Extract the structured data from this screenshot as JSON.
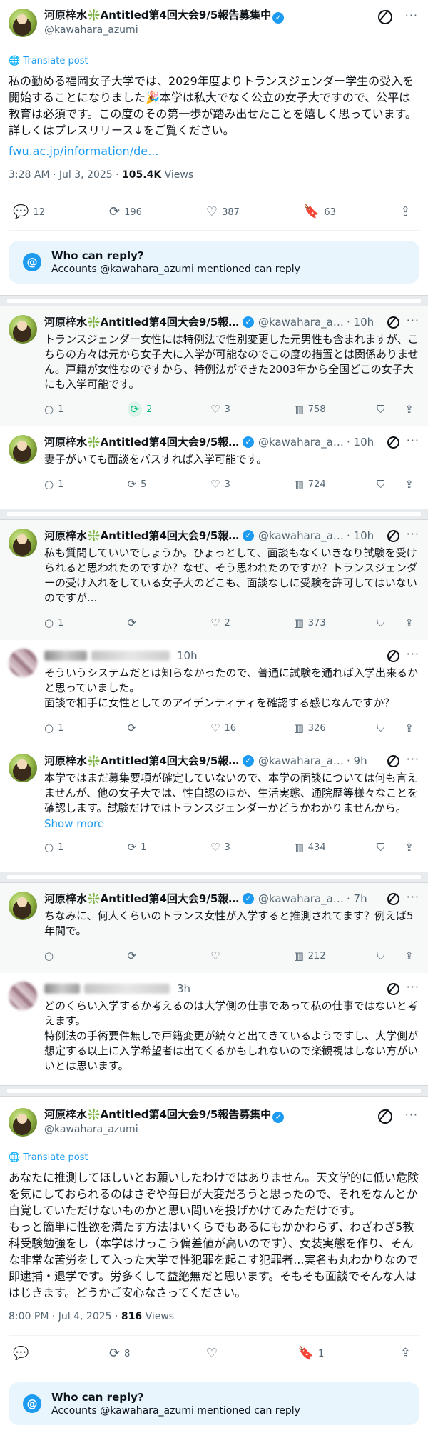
{
  "main_tweet": {
    "name": "河原梓水❇️Antitled第4回大会9/5報告募集中",
    "handle": "@kawahara_azumi",
    "translate": "Translate post",
    "text": "私の勤める福岡女子大学では、2029年度よりトランスジェンダー学生の受入を開始することになりました🎉本学は私大でなく公立の女子大ですので、公平は教育は必須です。この度のその第一歩が踏み出せたことを嬉しく思っています。詳しくはプレスリリース↓をご覧ください。",
    "link": "fwu.ac.jp/information/de...",
    "time": "3:28 AM · Jul 3, 2025 · ",
    "views": "105.4K",
    "views_label": " Views",
    "replies": "12",
    "retweets": "196",
    "likes": "387",
    "bookmarks": "63"
  },
  "reply_box": {
    "title": "Who can reply?",
    "subtitle": "Accounts @kawahara_azumi mentioned can reply"
  },
  "thread1": [
    {
      "name": "河原梓水❇️Antitled第4回大会9/5報告...",
      "handle": "@kawahara_az...",
      "time": "· 10h",
      "text": "トランスジェンダー女性には特例法で性別変更した元男性も含まれますが、こちらの方々は元から女子大に入学が可能なのでこの度の措置とは関係ありません。戸籍が女性なのですから、特例法ができた2003年から全国どこの女子大にも入学可能です。",
      "replies": "1",
      "retweets": "2",
      "likes": "3",
      "views": "758"
    },
    {
      "name": "河原梓水❇️Antitled第4回大会9/5報告...",
      "handle": "@kawahara_az...",
      "time": "· 10h",
      "text": "妻子がいても面談をパスすれば入学可能です。",
      "replies": "1",
      "retweets": "5",
      "likes": "3",
      "views": "724"
    }
  ],
  "thread2": [
    {
      "name": "河原梓水❇️Antitled第4回大会9/5報告...",
      "handle": "@kawahara_az...",
      "time": "· 10h",
      "text": "私も質問していいでしょうか。ひょっとして、面談もなくいきなり試験を受けられると思われたのですか？なぜ、そう思われたのですか？トランスジェンダーの受け入れをしている女子大のどこも、面談なしに受験を許可してはいないのですが...",
      "replies": "1",
      "retweets": "",
      "likes": "2",
      "views": "373"
    },
    {
      "time": "10h",
      "text": "そういうシステムだとは知らなかったので、普通に試験を通れば入学出来るかと思っていました。\n面談で相手に女性としてのアイデンティティを確認する感じなんですか？",
      "replies": "1",
      "retweets": "",
      "likes": "16",
      "views": "326"
    },
    {
      "name": "河原梓水❇️Antitled第4回大会9/5報告募...",
      "handle": "@kawahara_az...",
      "time": "· 9h",
      "text": "本学ではまだ募集要項が確定していないので、本学の面談については何も言えませんが、他の女子大では、性自認のほか、生活実態、通院歴等様々なことを確認します。試験だけではトランスジェンダーかどうかわかりませんから。",
      "show_more": "Show more",
      "replies": "1",
      "retweets": "1",
      "likes": "3",
      "views": "434"
    }
  ],
  "thread3": [
    {
      "name": "河原梓水❇️Antitled第4回大会9/5報告募...",
      "handle": "@kawahara_az...",
      "time": "· 7h",
      "text": "ちなみに、何人くらいのトランス女性が入学すると推測されてます？例えば5年間で。",
      "replies": "",
      "retweets": "",
      "likes": "",
      "views": "212"
    },
    {
      "time": "3h",
      "text": "どのくらい入学するか考えるのは大学側の仕事であって私の仕事ではないと考えます。\n特例法の手術要件無しで戸籍変更が続々と出てきているようですし、大学側が想定する以上に入学希望者は出てくるかもしれないので楽観視はしない方がいいとは思います。",
      "replies": "",
      "retweets": "",
      "likes": "",
      "views": ""
    }
  ],
  "final_tweet": {
    "name": "河原梓水❇️Antitled第4回大会9/5報告募集中",
    "handle": "@kawahara_azumi",
    "translate": "Translate post",
    "text": "あなたに推測してほしいとお願いしたわけではありません。天文学的に低い危険を気にしておられるのはさぞや毎日が大変だろうと思ったので、それをなんとか自覚していただけないものかと思い問いを投げかけてみただけです。\nもっと簡単に性欲を満たす方法はいくらでもあるにもかかわらず、わざわざ5教科受験勉強をし（本学はけっこう偏差値が高いのです）、女装実態を作り、そんな非常な苦労をして入った大学で性犯罪を起こす犯罪者...実名も丸わかりなので即逮捕・退学です。労多くして益絶無だと思います。そもそも面談でそんな人ははじきます。どうかご安心なさってください。",
    "time": "8:00 PM · Jul 4, 2025 · ",
    "views": "816",
    "views_label": " Views",
    "replies": "",
    "retweets": "8",
    "likes": "",
    "bookmarks": "1"
  },
  "icons": {
    "reply": "reply-icon",
    "retweet": "retweet-icon",
    "like": "heart-icon",
    "views": "views-icon",
    "bookmark": "bookmark-icon",
    "share": "share-icon",
    "grok": "grok-icon",
    "more": "more-icon"
  },
  "colors": {
    "accent": "#1d9bf0",
    "green": "#00ba7c",
    "reply_box_bg": "#e8f5fd"
  }
}
